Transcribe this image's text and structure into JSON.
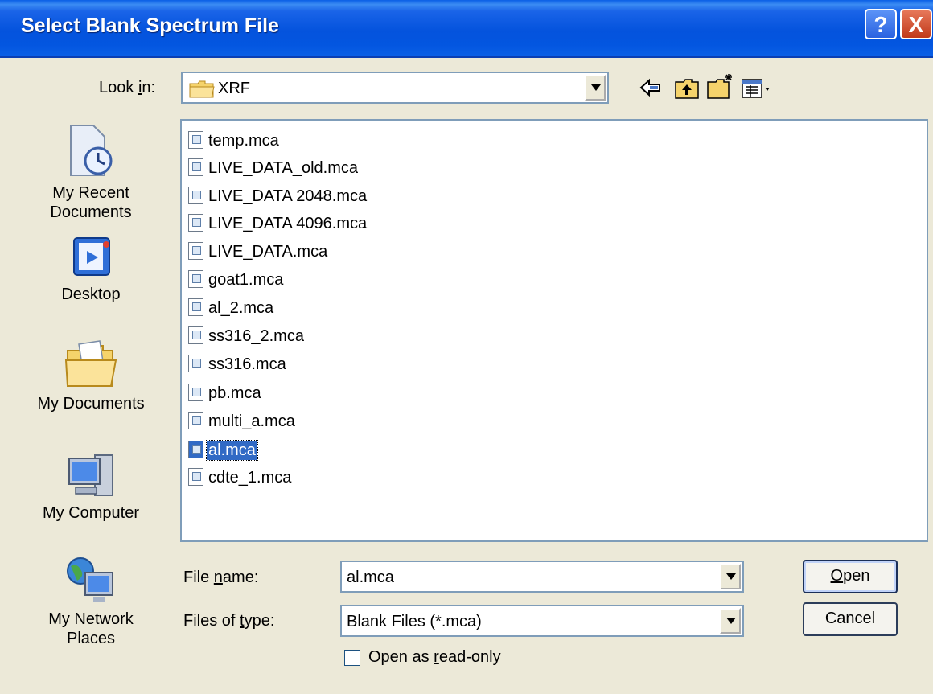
{
  "window": {
    "title": "Select Blank Spectrum File",
    "help_glyph": "?",
    "close_glyph": "X"
  },
  "lookin": {
    "label_pre": "Look ",
    "label_accel": "i",
    "label_post": "n:",
    "value": "XRF"
  },
  "toolbar": {
    "back_icon": "back-arrow-icon",
    "up_icon": "up-folder-icon",
    "new_folder_icon": "new-folder-icon",
    "views_icon": "views-menu-icon"
  },
  "places": [
    {
      "label": "My Recent Documents",
      "line1": "My Recent",
      "line2": "Documents",
      "icon": "recent-documents-icon"
    },
    {
      "label": "Desktop",
      "icon": "desktop-icon"
    },
    {
      "label": "My Documents",
      "icon": "my-documents-icon"
    },
    {
      "label": "My Computer",
      "icon": "my-computer-icon"
    },
    {
      "label": "My Network Places",
      "line1": "My Network",
      "line2": "Places",
      "icon": "network-places-icon"
    }
  ],
  "files": [
    {
      "name": "temp.mca"
    },
    {
      "name": "LIVE_DATA_old.mca"
    },
    {
      "name": "LIVE_DATA 2048.mca"
    },
    {
      "name": "LIVE_DATA 4096.mca"
    },
    {
      "name": "LIVE_DATA.mca"
    },
    {
      "name": "goat1.mca"
    },
    {
      "name": "al_2.mca"
    },
    {
      "name": "ss316_2.mca"
    },
    {
      "name": "ss316.mca"
    },
    {
      "name": "pb.mca"
    },
    {
      "name": "multi_a.mca"
    },
    {
      "name": "al.mca",
      "selected": true
    },
    {
      "name": "cdte_1.mca"
    }
  ],
  "filename": {
    "label_pre": "File ",
    "label_accel": "n",
    "label_post": "ame:",
    "value": "al.mca"
  },
  "filetype": {
    "label_pre": "Files of ",
    "label_accel": "t",
    "label_post": "ype:",
    "value": "Blank Files (*.mca)"
  },
  "readonly": {
    "label_pre": "Open as ",
    "label_accel": "r",
    "label_post": "ead-only",
    "checked": false
  },
  "buttons": {
    "open_accel": "O",
    "open_rest": "pen",
    "cancel": "Cancel"
  }
}
